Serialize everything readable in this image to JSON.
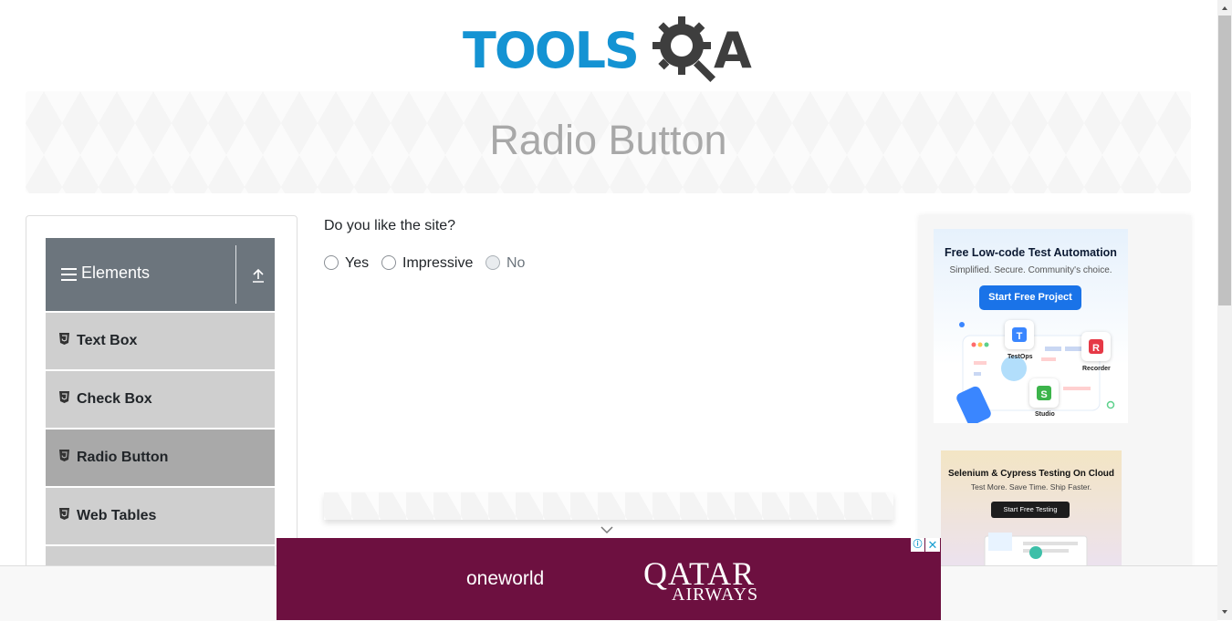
{
  "logo": {
    "tools": "TOOLS",
    "a": "A"
  },
  "page": {
    "title": "Radio Button"
  },
  "sidebar": {
    "group_title": "Elements",
    "items": [
      {
        "label": "Text Box"
      },
      {
        "label": "Check Box"
      },
      {
        "label": "Radio Button"
      },
      {
        "label": "Web Tables"
      }
    ]
  },
  "form": {
    "question": "Do you like the site?",
    "options": [
      {
        "label": "Yes",
        "disabled": false
      },
      {
        "label": "Impressive",
        "disabled": false
      },
      {
        "label": "No",
        "disabled": true
      }
    ]
  },
  "ads": {
    "ad1": {
      "title": "Free Low-code Test Automation",
      "subtitle": "Simplified. Secure. Community's choice.",
      "button": "Start Free Project",
      "tiles": [
        "TestOps",
        "Recorder",
        "Studio"
      ]
    },
    "ad2": {
      "title": "Selenium & Cypress Testing On Cloud",
      "subtitle": "Test More. Save Time. Ship Faster.",
      "button": "Start Free Testing"
    },
    "bottom": {
      "oneworld": "oneworld",
      "qatar": "QATAR",
      "airways": "AIRWAYS"
    }
  },
  "colors": {
    "brand_blue": "#1493d3",
    "sidebar_header": "#6c757d",
    "menu_item": "#cfcfcf",
    "menu_item_active": "#a9a9a9",
    "qatar": "#6d1040"
  }
}
